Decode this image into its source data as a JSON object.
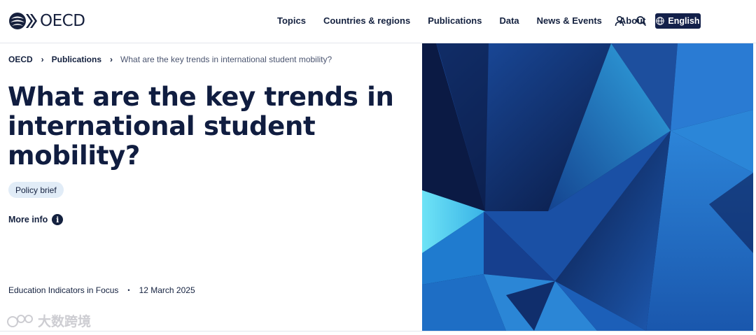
{
  "header": {
    "logo_text": "OECD",
    "nav": [
      "Topics",
      "Countries & regions",
      "Publications",
      "Data",
      "News & Events",
      "About"
    ],
    "language_label": "English",
    "icons": [
      "oecd-logo-icon",
      "user-icon",
      "search-icon",
      "globe-icon"
    ]
  },
  "breadcrumb": {
    "home": "OECD",
    "section": "Publications",
    "current": "What are the key trends in international student mobility?"
  },
  "page": {
    "title": "What are the key trends in international student mobility?",
    "badge": "Policy brief",
    "more_info": "More info",
    "series": "Education Indicators in Focus",
    "separator": "•",
    "date": "12 March 2025"
  },
  "watermark": {
    "text": "大数跨境"
  },
  "colors": {
    "navy": "#101d40",
    "badge_bg": "#e1ecf7",
    "hero_dark": "#0b1c45",
    "hero_mid": "#1f5fb5",
    "hero_light": "#4fd0ef"
  }
}
